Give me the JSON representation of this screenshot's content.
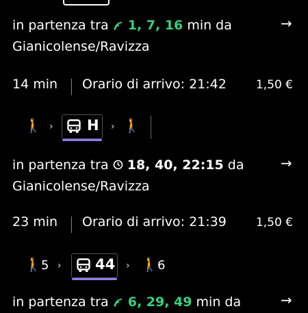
{
  "trips": [
    {
      "departure_prefix": "in partenza tra",
      "departure_times": "1, 7, 16",
      "departure_suffix": "min da",
      "departure_mode": "live",
      "stop": "Gianicolense/Ravizza",
      "duration": "14 min",
      "arrival": "Orario di arrivo: 21:42",
      "price": "1,50 €",
      "walk_before": "",
      "bus_route": "H",
      "walk_after": ""
    },
    {
      "departure_prefix": "in partenza tra",
      "departure_times": "18, 40, 22:15",
      "departure_suffix": "da",
      "departure_mode": "scheduled",
      "stop": "Gianicolense/Ravizza",
      "duration": "23 min",
      "arrival": "Orario di arrivo: 21:39",
      "price": "1,50 €",
      "walk_before": "5",
      "bus_route": "44",
      "walk_after": "6"
    },
    {
      "departure_prefix": "in partenza tra",
      "departure_times": "6, 29, 49",
      "departure_suffix": "min da",
      "departure_mode": "live"
    }
  ],
  "colors": {
    "live": "#35d07f",
    "route_underline": "#8e7cf2",
    "background": "#000000"
  },
  "icons": {
    "live": "live-signal-icon",
    "scheduled": "clock-icon",
    "walk": "walk-icon",
    "bus": "bus-icon",
    "go": "arrow-right-icon"
  }
}
